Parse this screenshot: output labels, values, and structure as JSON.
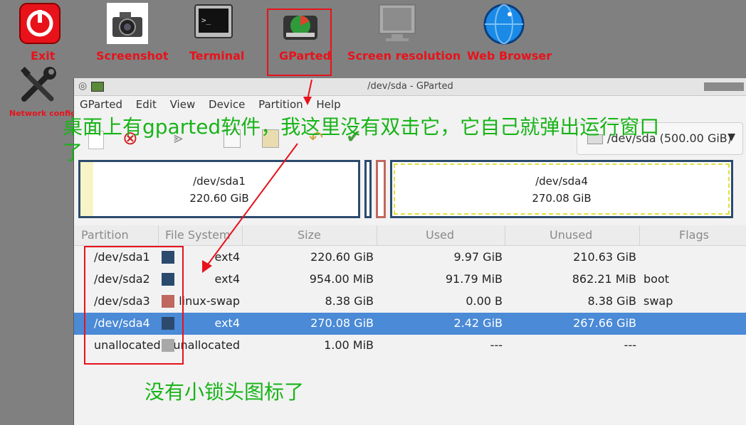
{
  "desktop": {
    "icons": [
      {
        "label": "Exit"
      },
      {
        "label": "Screenshot"
      },
      {
        "label": "Terminal"
      },
      {
        "label": "GParted"
      },
      {
        "label": "Screen resolution"
      },
      {
        "label": "Web Browser"
      },
      {
        "label": "Network config"
      }
    ]
  },
  "window": {
    "title": "/dev/sda - GParted",
    "menu": [
      "GParted",
      "Edit",
      "View",
      "Device",
      "Partition",
      "Help"
    ],
    "device_selector": "/dev/sda (500.00 GiB)"
  },
  "partition_map": [
    {
      "name": "/dev/sda1",
      "size": "220.60 GiB"
    },
    {
      "name": "/dev/sda4",
      "size": "270.08 GiB"
    }
  ],
  "table": {
    "headers": [
      "Partition",
      "File System",
      "Size",
      "Used",
      "Unused",
      "Flags"
    ],
    "rows": [
      {
        "partition": "/dev/sda1",
        "color": "#2c4a6e",
        "fs": "ext4",
        "size": "220.60 GiB",
        "used": "9.97 GiB",
        "unused": "210.63 GiB",
        "flags": ""
      },
      {
        "partition": "/dev/sda2",
        "color": "#2c4a6e",
        "fs": "ext4",
        "size": "954.00 MiB",
        "used": "91.79 MiB",
        "unused": "862.21 MiB",
        "flags": "boot"
      },
      {
        "partition": "/dev/sda3",
        "color": "#c0685f",
        "fs": "linux-swap",
        "size": "8.38 GiB",
        "used": "0.00 B",
        "unused": "8.38 GiB",
        "flags": "swap"
      },
      {
        "partition": "/dev/sda4",
        "color": "#2c4a6e",
        "fs": "ext4",
        "size": "270.08 GiB",
        "used": "2.42 GiB",
        "unused": "267.66 GiB",
        "flags": ""
      },
      {
        "partition": "unallocated",
        "color": "#a8a8a8",
        "fs": "unallocated",
        "size": "1.00 MiB",
        "used": "---",
        "unused": "---",
        "flags": ""
      }
    ]
  },
  "annotations": {
    "top_note_line1": "桌面上有gparted软件，我这里没有双击它，它自己就弹出运行窗口",
    "top_note_line2": "了",
    "bottom_note": "没有小锁头图标了"
  },
  "colors": {
    "annotation_red": "#e8121b",
    "annotation_green": "#18b418",
    "selection": "#4a8ad6"
  }
}
